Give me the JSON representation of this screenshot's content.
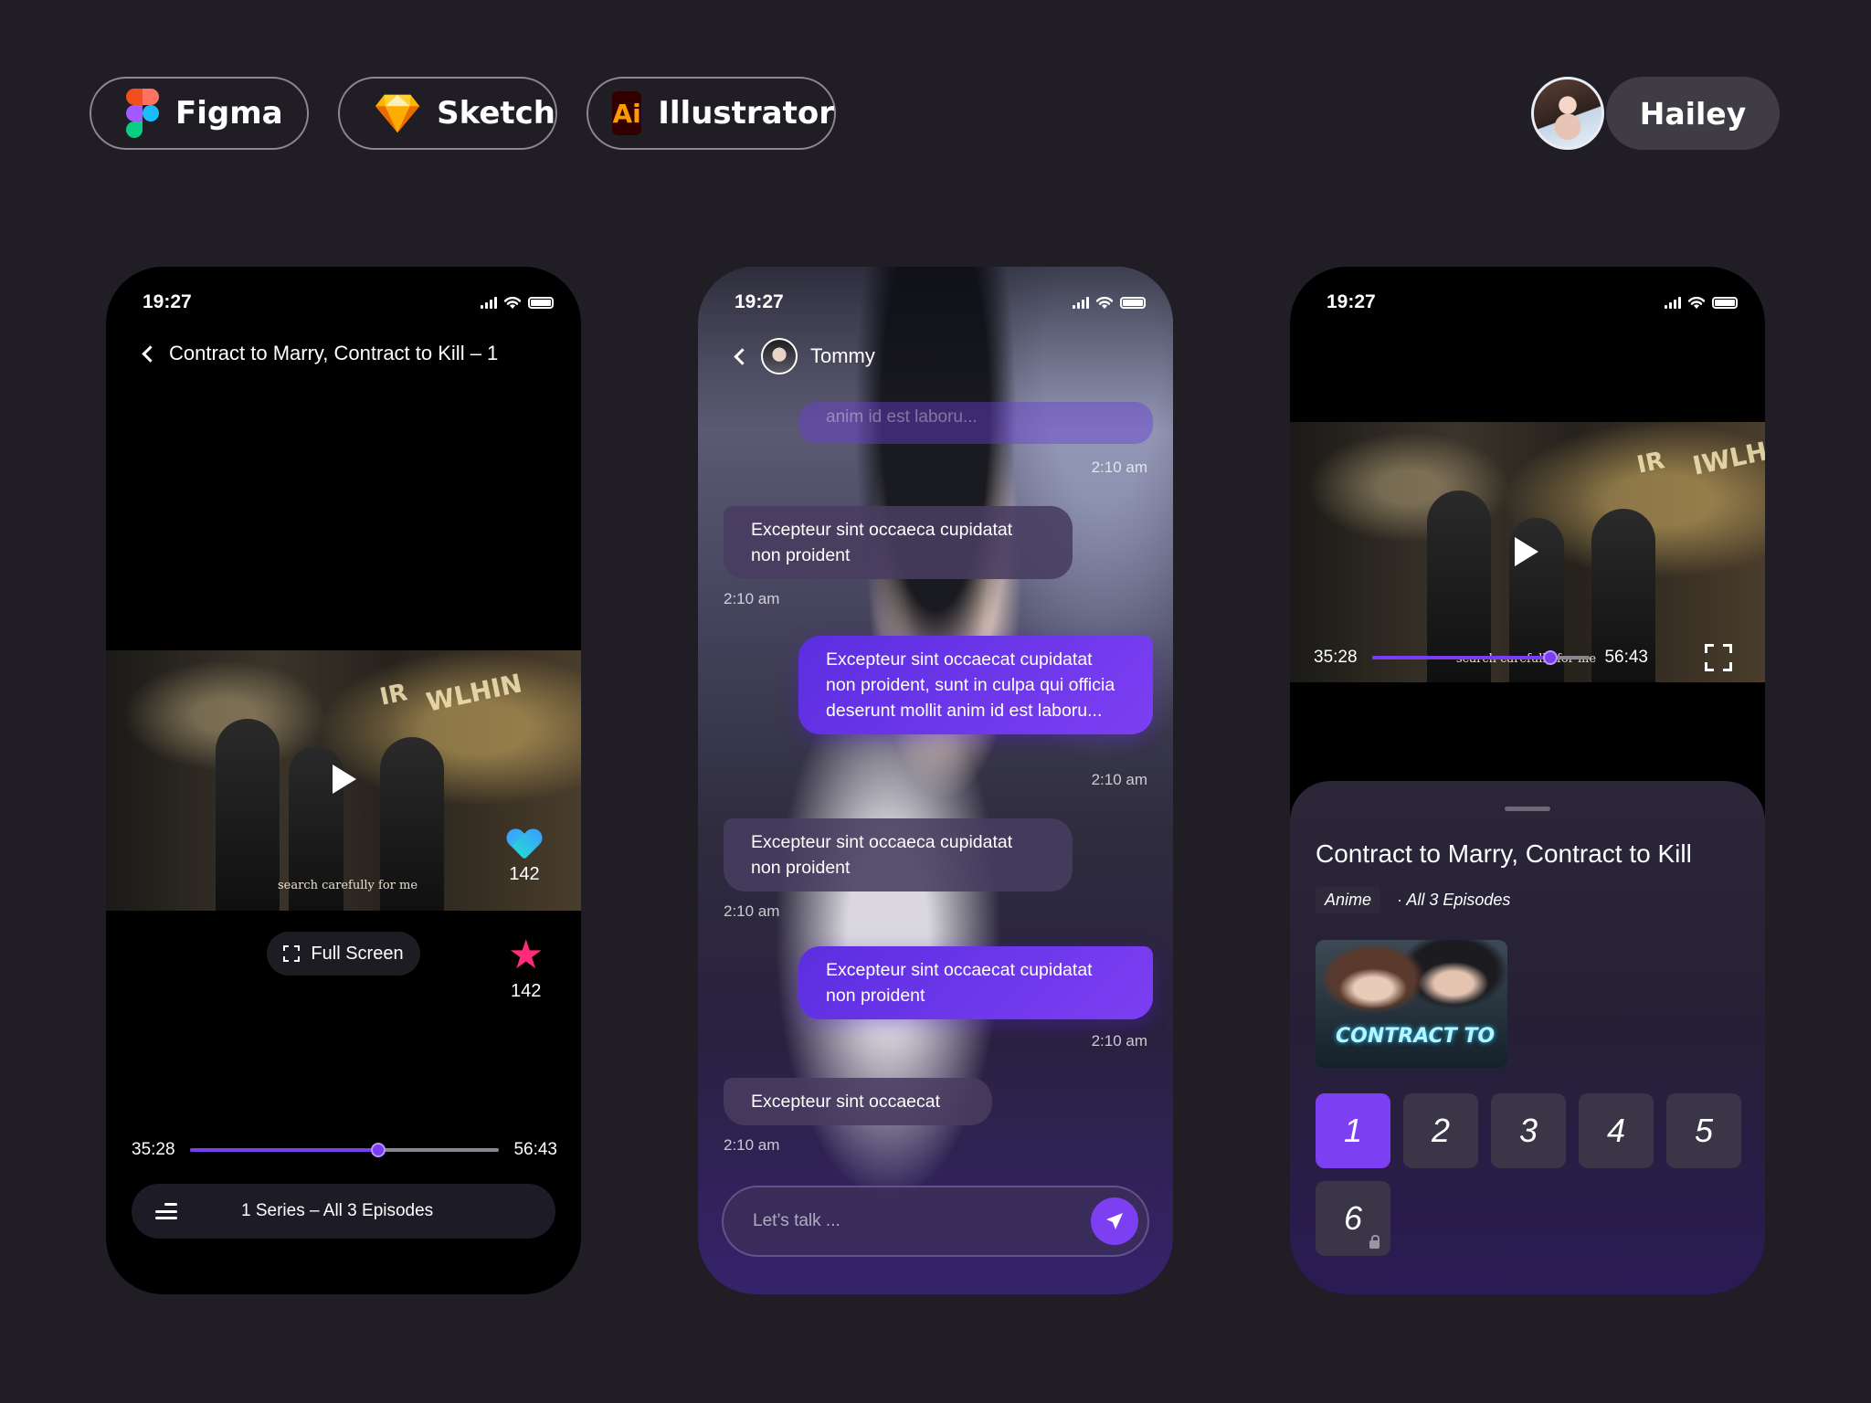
{
  "toolbar": {
    "tools": [
      {
        "label": "Figma",
        "icon": "figma-logo-icon"
      },
      {
        "label": "Sketch",
        "icon": "sketch-diamond-icon"
      },
      {
        "label": "Illustrator",
        "icon": "illustrator-logo-icon",
        "badge": "Ai"
      }
    ],
    "user": {
      "name": "Hailey",
      "icon": "avatar"
    }
  },
  "colors": {
    "accent": "#7d3ff2",
    "background": "#201d24",
    "star": "#ff2a7a"
  },
  "player": {
    "status_time": "19:27",
    "title": "Contract to Marry, Contract to Kill – 1",
    "subtitle": "search carefully for me",
    "likes": "142",
    "favorites": "142",
    "full_screen_label": "Full Screen",
    "current_time": "35:28",
    "total_time": "56:43",
    "progress": 0.61,
    "series_label": "1 Series – All 3 Episodes"
  },
  "chat": {
    "status_time": "19:27",
    "contact_name": "Tommy",
    "ghost_text": "anim id est laboru...",
    "messages": [
      {
        "side": "in",
        "text": "Excepteur sint occaeca cupidatat non proident",
        "time": "2:10 am",
        "top_time": "2:10 am"
      },
      {
        "side": "out",
        "text": "Excepteur sint occaecat cupidatat non proident, sunt in culpa qui officia deserunt mollit anim id est laboru...",
        "time": "2:10 am"
      },
      {
        "side": "in",
        "text": "Excepteur sint occaeca cupidatat non proident",
        "time": "2:10 am"
      },
      {
        "side": "out",
        "text": "Excepteur sint occaecat cupidatat non proident",
        "time": "2:10 am"
      },
      {
        "side": "in",
        "text": "Excepteur sint occaecat",
        "time": "2:10 am"
      }
    ],
    "input_placeholder": "Let’s talk ..."
  },
  "episodes": {
    "status_time": "19:27",
    "subtitle": "search carefully for me",
    "current_time": "35:28",
    "total_time": "56:43",
    "progress": 0.82,
    "title": "Contract to Marry, Contract to Kill",
    "genre": "Anime",
    "episode_count": "· All 3 Episodes",
    "poster_text": "CONTRACT TO",
    "list": [
      "1",
      "2",
      "3",
      "4",
      "5",
      "6"
    ],
    "active": "1",
    "locked": [
      "6"
    ]
  }
}
